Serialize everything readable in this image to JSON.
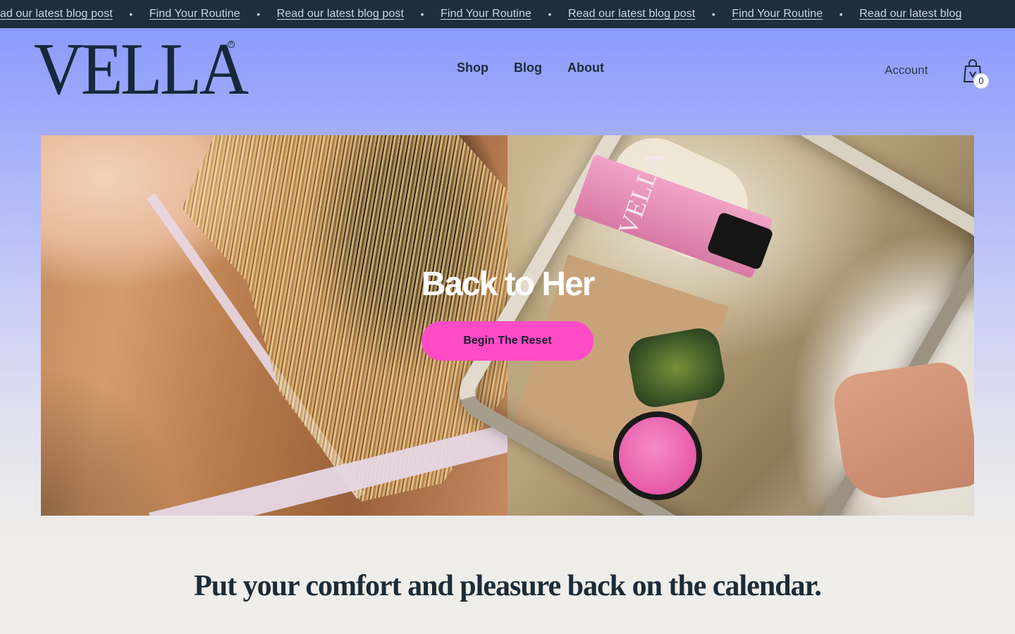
{
  "announcement": {
    "items": [
      "ead our latest blog post",
      "Find Your Routine",
      "Read our latest blog post",
      "Find Your Routine",
      "Read our latest blog post",
      "Find Your Routine",
      "Read our latest blog"
    ],
    "separator": "•"
  },
  "header": {
    "logo": "VELLA",
    "logo_mark": "R",
    "nav": [
      "Shop",
      "Blog",
      "About"
    ],
    "account": "Account",
    "cart_count": "0"
  },
  "hero": {
    "title": "Back to Her",
    "cta": "Begin The Reset",
    "product_text": "VELLA"
  },
  "tagline": "Put your comfort and pleasure back on the calendar.",
  "colors": {
    "announce_bg": "#1c2f3a",
    "header_gradient_top": "#8b9bfb",
    "cta_pink": "#ff4bc6",
    "page_bg": "#efeeea",
    "text_dark": "#1a2b3a"
  }
}
